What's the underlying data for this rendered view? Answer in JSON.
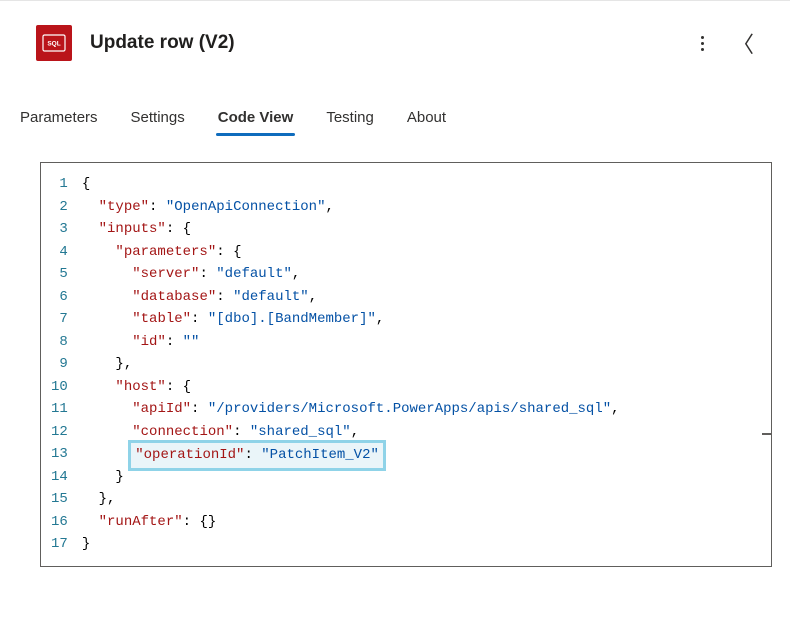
{
  "header": {
    "title": "Update row (V2)",
    "icon_label": "SQL"
  },
  "tabs": {
    "parameters": "Parameters",
    "settings": "Settings",
    "codeview": "Code View",
    "testing": "Testing",
    "about": "About"
  },
  "code": {
    "k_type": "\"type\"",
    "v_type": "\"OpenApiConnection\"",
    "k_inputs": "\"inputs\"",
    "k_parameters": "\"parameters\"",
    "k_server": "\"server\"",
    "v_server": "\"default\"",
    "k_database": "\"database\"",
    "v_database": "\"default\"",
    "k_table": "\"table\"",
    "v_table": "\"[dbo].[BandMember]\"",
    "k_id": "\"id\"",
    "v_id": "\"\"",
    "k_host": "\"host\"",
    "k_apiId": "\"apiId\"",
    "v_apiId": "\"/providers/Microsoft.PowerApps/apis/shared_sql\"",
    "k_connection": "\"connection\"",
    "v_connection": "\"shared_sql\"",
    "k_operationId": "\"operationId\"",
    "v_operationId": "\"PatchItem_V2\"",
    "k_runAfter": "\"runAfter\"",
    "brace_open": "{",
    "brace_close": "}",
    "brace_close_comma": "},",
    "colon_sp": ": ",
    "comma": ",",
    "empty_obj": "{}"
  },
  "lineNumbers": [
    "1",
    "2",
    "3",
    "4",
    "5",
    "6",
    "7",
    "8",
    "9",
    "10",
    "11",
    "12",
    "13",
    "14",
    "15",
    "16",
    "17"
  ]
}
